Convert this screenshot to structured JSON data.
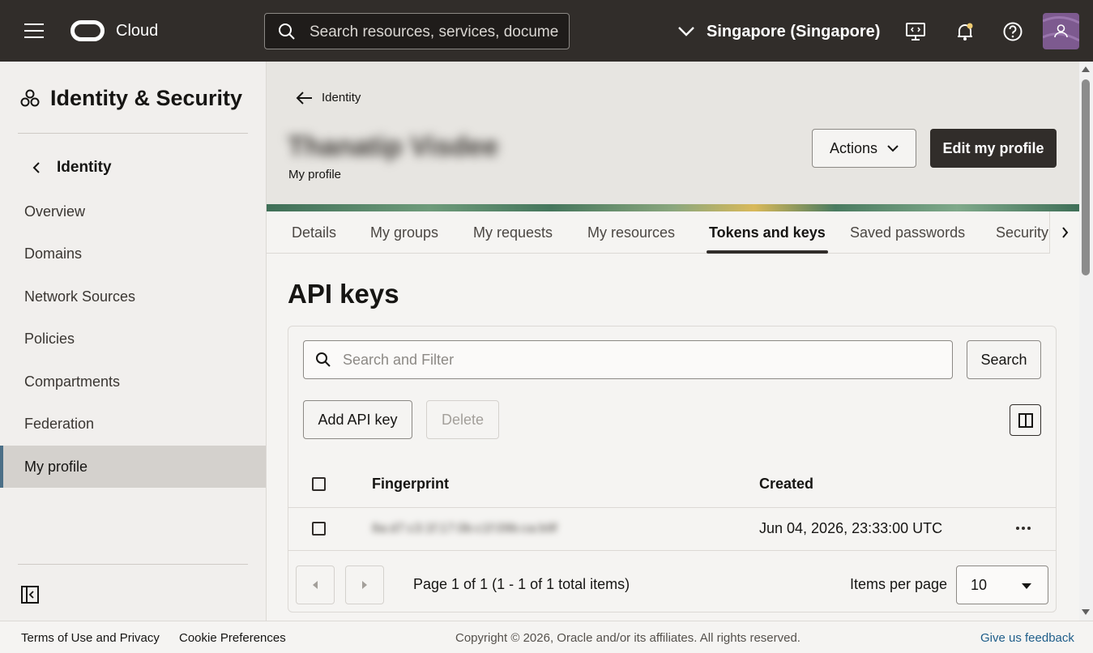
{
  "topbar": {
    "brand": "Cloud",
    "search_placeholder": "Search resources, services, docume",
    "region": "Singapore (Singapore)"
  },
  "sidebar": {
    "title": "Identity & Security",
    "back_label": "Identity",
    "items": [
      {
        "label": "Overview"
      },
      {
        "label": "Domains"
      },
      {
        "label": "Network Sources"
      },
      {
        "label": "Policies"
      },
      {
        "label": "Compartments"
      },
      {
        "label": "Federation"
      },
      {
        "label": "My profile",
        "active": true
      }
    ]
  },
  "header": {
    "back_label": "Identity",
    "user_name": "Thanatip Visdee",
    "subtitle": "My profile",
    "actions_label": "Actions",
    "edit_label": "Edit my profile"
  },
  "tabs": [
    {
      "label": "Details"
    },
    {
      "label": "My groups"
    },
    {
      "label": "My requests"
    },
    {
      "label": "My resources"
    },
    {
      "label": "Tokens and keys",
      "active": true
    },
    {
      "label": "Saved passwords"
    },
    {
      "label": "Security"
    }
  ],
  "api_keys": {
    "title": "API keys",
    "filter_placeholder": "Search and Filter",
    "search_label": "Search",
    "add_label": "Add API key",
    "delete_label": "Delete",
    "columns": {
      "fingerprint": "Fingerprint",
      "created": "Created"
    },
    "rows": [
      {
        "fingerprint": "8a:d7:c3:1f:17:0b:c1f:09b:ca:b9f",
        "created": "Jun 04, 2026, 23:33:00 UTC"
      }
    ],
    "pagination": {
      "text": "Page 1 of 1 (1 - 1 of 1 total items)",
      "items_per_page_label": "Items per page",
      "items_per_page": "10"
    }
  },
  "footer": {
    "terms": "Terms of Use and Privacy",
    "cookies": "Cookie Preferences",
    "copyright": "Copyright © 2026, Oracle and/or its affiliates. All rights reserved.",
    "feedback": "Give us feedback"
  },
  "colors": {
    "topbar": "#312d2a",
    "accent": "#4b6f87",
    "primary_button": "#312d2a"
  }
}
